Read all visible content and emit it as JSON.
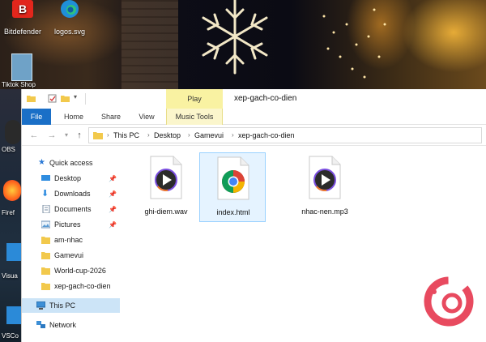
{
  "desktop": {
    "icons": [
      {
        "label": "Bitdefender",
        "icon": "bitdefender-icon"
      },
      {
        "label": "logos.svg",
        "icon": "edge-icon"
      }
    ],
    "strip_labels": [
      "Tiktok Shop",
      "OBS",
      "Firef",
      "Visua",
      "VSCo"
    ]
  },
  "window": {
    "title": "xep-gach-co-dien",
    "context_tab_group": "Play"
  },
  "ribbon": {
    "tabs": [
      "File",
      "Home",
      "Share",
      "View",
      "Music Tools"
    ]
  },
  "address": {
    "crumbs": [
      "This PC",
      "Desktop",
      "Gamevui",
      "xep-gach-co-dien"
    ]
  },
  "nav": {
    "quick_access": "Quick access",
    "items": [
      {
        "label": "Desktop",
        "pinned": true
      },
      {
        "label": "Downloads",
        "pinned": true
      },
      {
        "label": "Documents",
        "pinned": true
      },
      {
        "label": "Pictures",
        "pinned": true
      },
      {
        "label": "am-nhac",
        "pinned": false
      },
      {
        "label": "Gamevui",
        "pinned": false
      },
      {
        "label": "World-cup-2026",
        "pinned": false
      },
      {
        "label": "xep-gach-co-dien",
        "pinned": false
      }
    ],
    "this_pc": "This PC",
    "network": "Network"
  },
  "files": [
    {
      "name": "ghi-diem.wav",
      "type": "media"
    },
    {
      "name": "index.html",
      "type": "chrome"
    },
    {
      "name": "nhac-nen.mp3",
      "type": "media"
    }
  ],
  "colors": {
    "file_tab": "#1a6fc7",
    "selection": "#cce4f7",
    "context_tab": "#f9f2a2",
    "brand": "#e84a5f"
  }
}
